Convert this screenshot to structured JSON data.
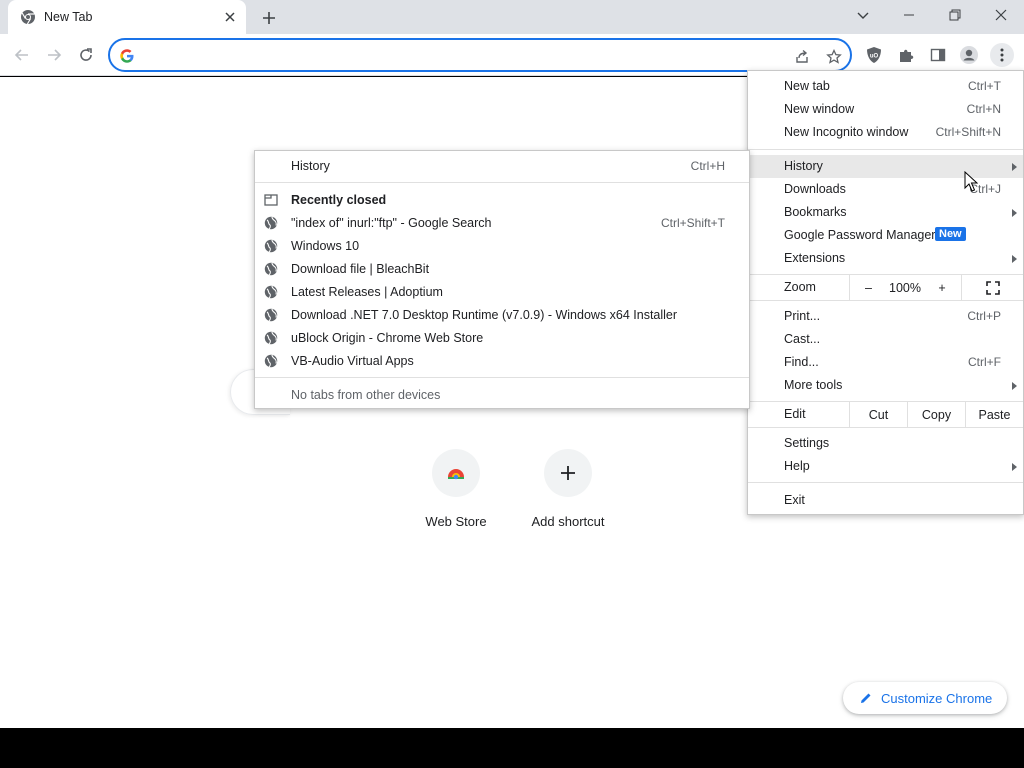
{
  "tab": {
    "title": "New Tab"
  },
  "omnibox": {
    "value": "",
    "placeholder": ""
  },
  "shortcuts": [
    {
      "label": "Web Store"
    },
    {
      "label": "Add shortcut"
    }
  ],
  "customize_label": "Customize Chrome",
  "menu": {
    "new_tab": {
      "label": "New tab",
      "shortcut": "Ctrl+T"
    },
    "new_window": {
      "label": "New window",
      "shortcut": "Ctrl+N"
    },
    "new_incognito": {
      "label": "New Incognito window",
      "shortcut": "Ctrl+Shift+N"
    },
    "history": {
      "label": "History"
    },
    "downloads": {
      "label": "Downloads",
      "shortcut": "Ctrl+J"
    },
    "bookmarks": {
      "label": "Bookmarks"
    },
    "password_manager": {
      "label": "Google Password Manager",
      "badge": "New"
    },
    "extensions": {
      "label": "Extensions"
    },
    "zoom": {
      "label": "Zoom",
      "minus": "–",
      "value": "100%",
      "plus": "+"
    },
    "print": {
      "label": "Print...",
      "shortcut": "Ctrl+P"
    },
    "cast": {
      "label": "Cast..."
    },
    "find": {
      "label": "Find...",
      "shortcut": "Ctrl+F"
    },
    "more_tools": {
      "label": "More tools"
    },
    "edit": {
      "label": "Edit",
      "cut": "Cut",
      "copy": "Copy",
      "paste": "Paste"
    },
    "settings": {
      "label": "Settings"
    },
    "help": {
      "label": "Help"
    },
    "exit": {
      "label": "Exit"
    }
  },
  "history_menu": {
    "history": {
      "label": "History",
      "shortcut": "Ctrl+H"
    },
    "recently_closed": "Recently closed",
    "items": [
      {
        "label": "\"index of\" inurl:\"ftp\" - Google Search",
        "shortcut": "Ctrl+Shift+T"
      },
      {
        "label": "Windows 10",
        "shortcut": ""
      },
      {
        "label": "Download file | BleachBit",
        "shortcut": ""
      },
      {
        "label": "Latest Releases | Adoptium",
        "shortcut": ""
      },
      {
        "label": "Download .NET 7.0 Desktop Runtime (v7.0.9) - Windows x64 Installer",
        "shortcut": ""
      },
      {
        "label": "uBlock Origin - Chrome Web Store",
        "shortcut": ""
      },
      {
        "label": "VB-Audio Virtual Apps",
        "shortcut": ""
      }
    ],
    "no_tabs": "No tabs from other devices"
  },
  "colors": {
    "accent": "#1a73e8",
    "tabstrip": "#dee1e6"
  }
}
